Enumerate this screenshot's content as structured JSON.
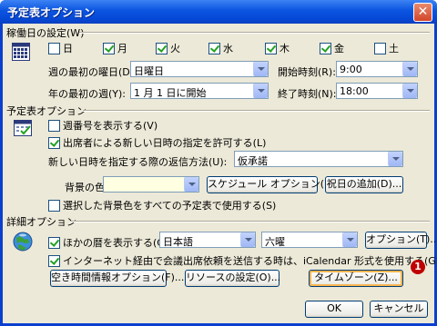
{
  "window": {
    "title": "予定表オプション"
  },
  "workdays": {
    "section_label": "稼働日の設定(W)",
    "days": [
      {
        "label": "日",
        "checked": false
      },
      {
        "label": "月",
        "checked": true
      },
      {
        "label": "火",
        "checked": true
      },
      {
        "label": "水",
        "checked": true
      },
      {
        "label": "木",
        "checked": true
      },
      {
        "label": "金",
        "checked": true
      },
      {
        "label": "土",
        "checked": false
      }
    ],
    "first_day_label": "週の最初の曜日(D):",
    "first_day_value": "日曜日",
    "start_time_label": "開始時刻(R):",
    "start_time_value": "9:00",
    "first_week_label": "年の最初の週(Y):",
    "first_week_value": "1 月 1 日に開始",
    "end_time_label": "終了時刻(N):",
    "end_time_value": "18:00"
  },
  "calendar_options": {
    "section_label": "予定表オプション",
    "show_week_numbers": {
      "label": "週番号を表示する(V)",
      "checked": false
    },
    "allow_propose_times": {
      "label": "出席者による新しい日時の指定を許可する(L)",
      "checked": true
    },
    "response_label": "新しい日時を指定する際の返信方法(U):",
    "response_value": "仮承諾",
    "bg_color_label": "背景の色(B):",
    "schedule_options_button": "スケジュール オプション(P)...",
    "add_holidays_button": "祝日の追加(D)...",
    "use_bg_all": {
      "label": "選択した背景色をすべての予定表で使用する(S)",
      "checked": false
    }
  },
  "advanced": {
    "section_label": "詳細オプション",
    "alt_calendar": {
      "label": "ほかの暦を表示する(C):",
      "checked": true
    },
    "alt_calendar_lang": "日本語",
    "alt_calendar_type": "六曜",
    "options_button": "オプション(T)...",
    "icalendar": {
      "label": "インターネット経由で会議出席依頼を送信する時は、iCalendar 形式を使用する(G)",
      "checked": true
    },
    "free_busy_button": "空き時間情報オプション(F)...",
    "resource_button": "リソースの設定(O)...",
    "timezone_button": "タイムゾーン(Z)...",
    "annotation_badge": "1"
  },
  "footer": {
    "ok": "OK",
    "cancel": "キャンセル"
  },
  "colors": {
    "title_bar": "#0a54e0",
    "dialog_bg": "#ece9d8",
    "badge": "#c00000",
    "bg_color_swatch": "#ffffe1"
  }
}
